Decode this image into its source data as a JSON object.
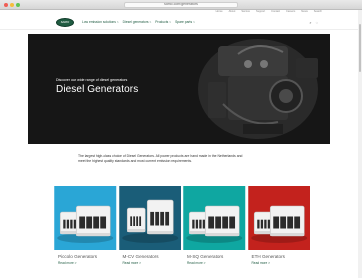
{
  "browser": {
    "url": "sdmo.com/generators"
  },
  "topbar": {
    "links": [
      "Home",
      "About",
      "Service",
      "Support",
      "Contact",
      "Careers",
      "News",
      "Search"
    ]
  },
  "nav": {
    "logo_text": "SDMO",
    "menu": [
      {
        "label": "Low emission solutions",
        "chevron": ">"
      },
      {
        "label": "Diesel generators",
        "chevron": ">"
      },
      {
        "label": "Products",
        "chevron": ">"
      },
      {
        "label": "Spare parts",
        "chevron": ">"
      }
    ],
    "icons": [
      "search-icon",
      "user-icon"
    ]
  },
  "hero": {
    "subtitle": "Discover our wide range of diesel generators",
    "title": "Diesel Generators"
  },
  "intro": {
    "text": "The largest high-class choice of Diesel Generators. All power products are hand made in the Netherlands and meet the highest quality standards and most current emission requirements."
  },
  "cards": [
    {
      "title": "Piccolo Generators",
      "link": "Read more  >",
      "bg": "#2aa6d6",
      "kind": "blue"
    },
    {
      "title": "M-CV Generators",
      "link": "Read more  >",
      "bg": "#1a5d78",
      "kind": "dark"
    },
    {
      "title": "M-SQ Generators",
      "link": "Read more  >",
      "bg": "#0fa7a1",
      "kind": "teal"
    },
    {
      "title": "ETH Generators",
      "link": "Read more  >",
      "bg": "#c3221d",
      "kind": "red"
    }
  ],
  "colors": {
    "brand_green": "#1f5b41",
    "hero_bg": "#161616"
  }
}
